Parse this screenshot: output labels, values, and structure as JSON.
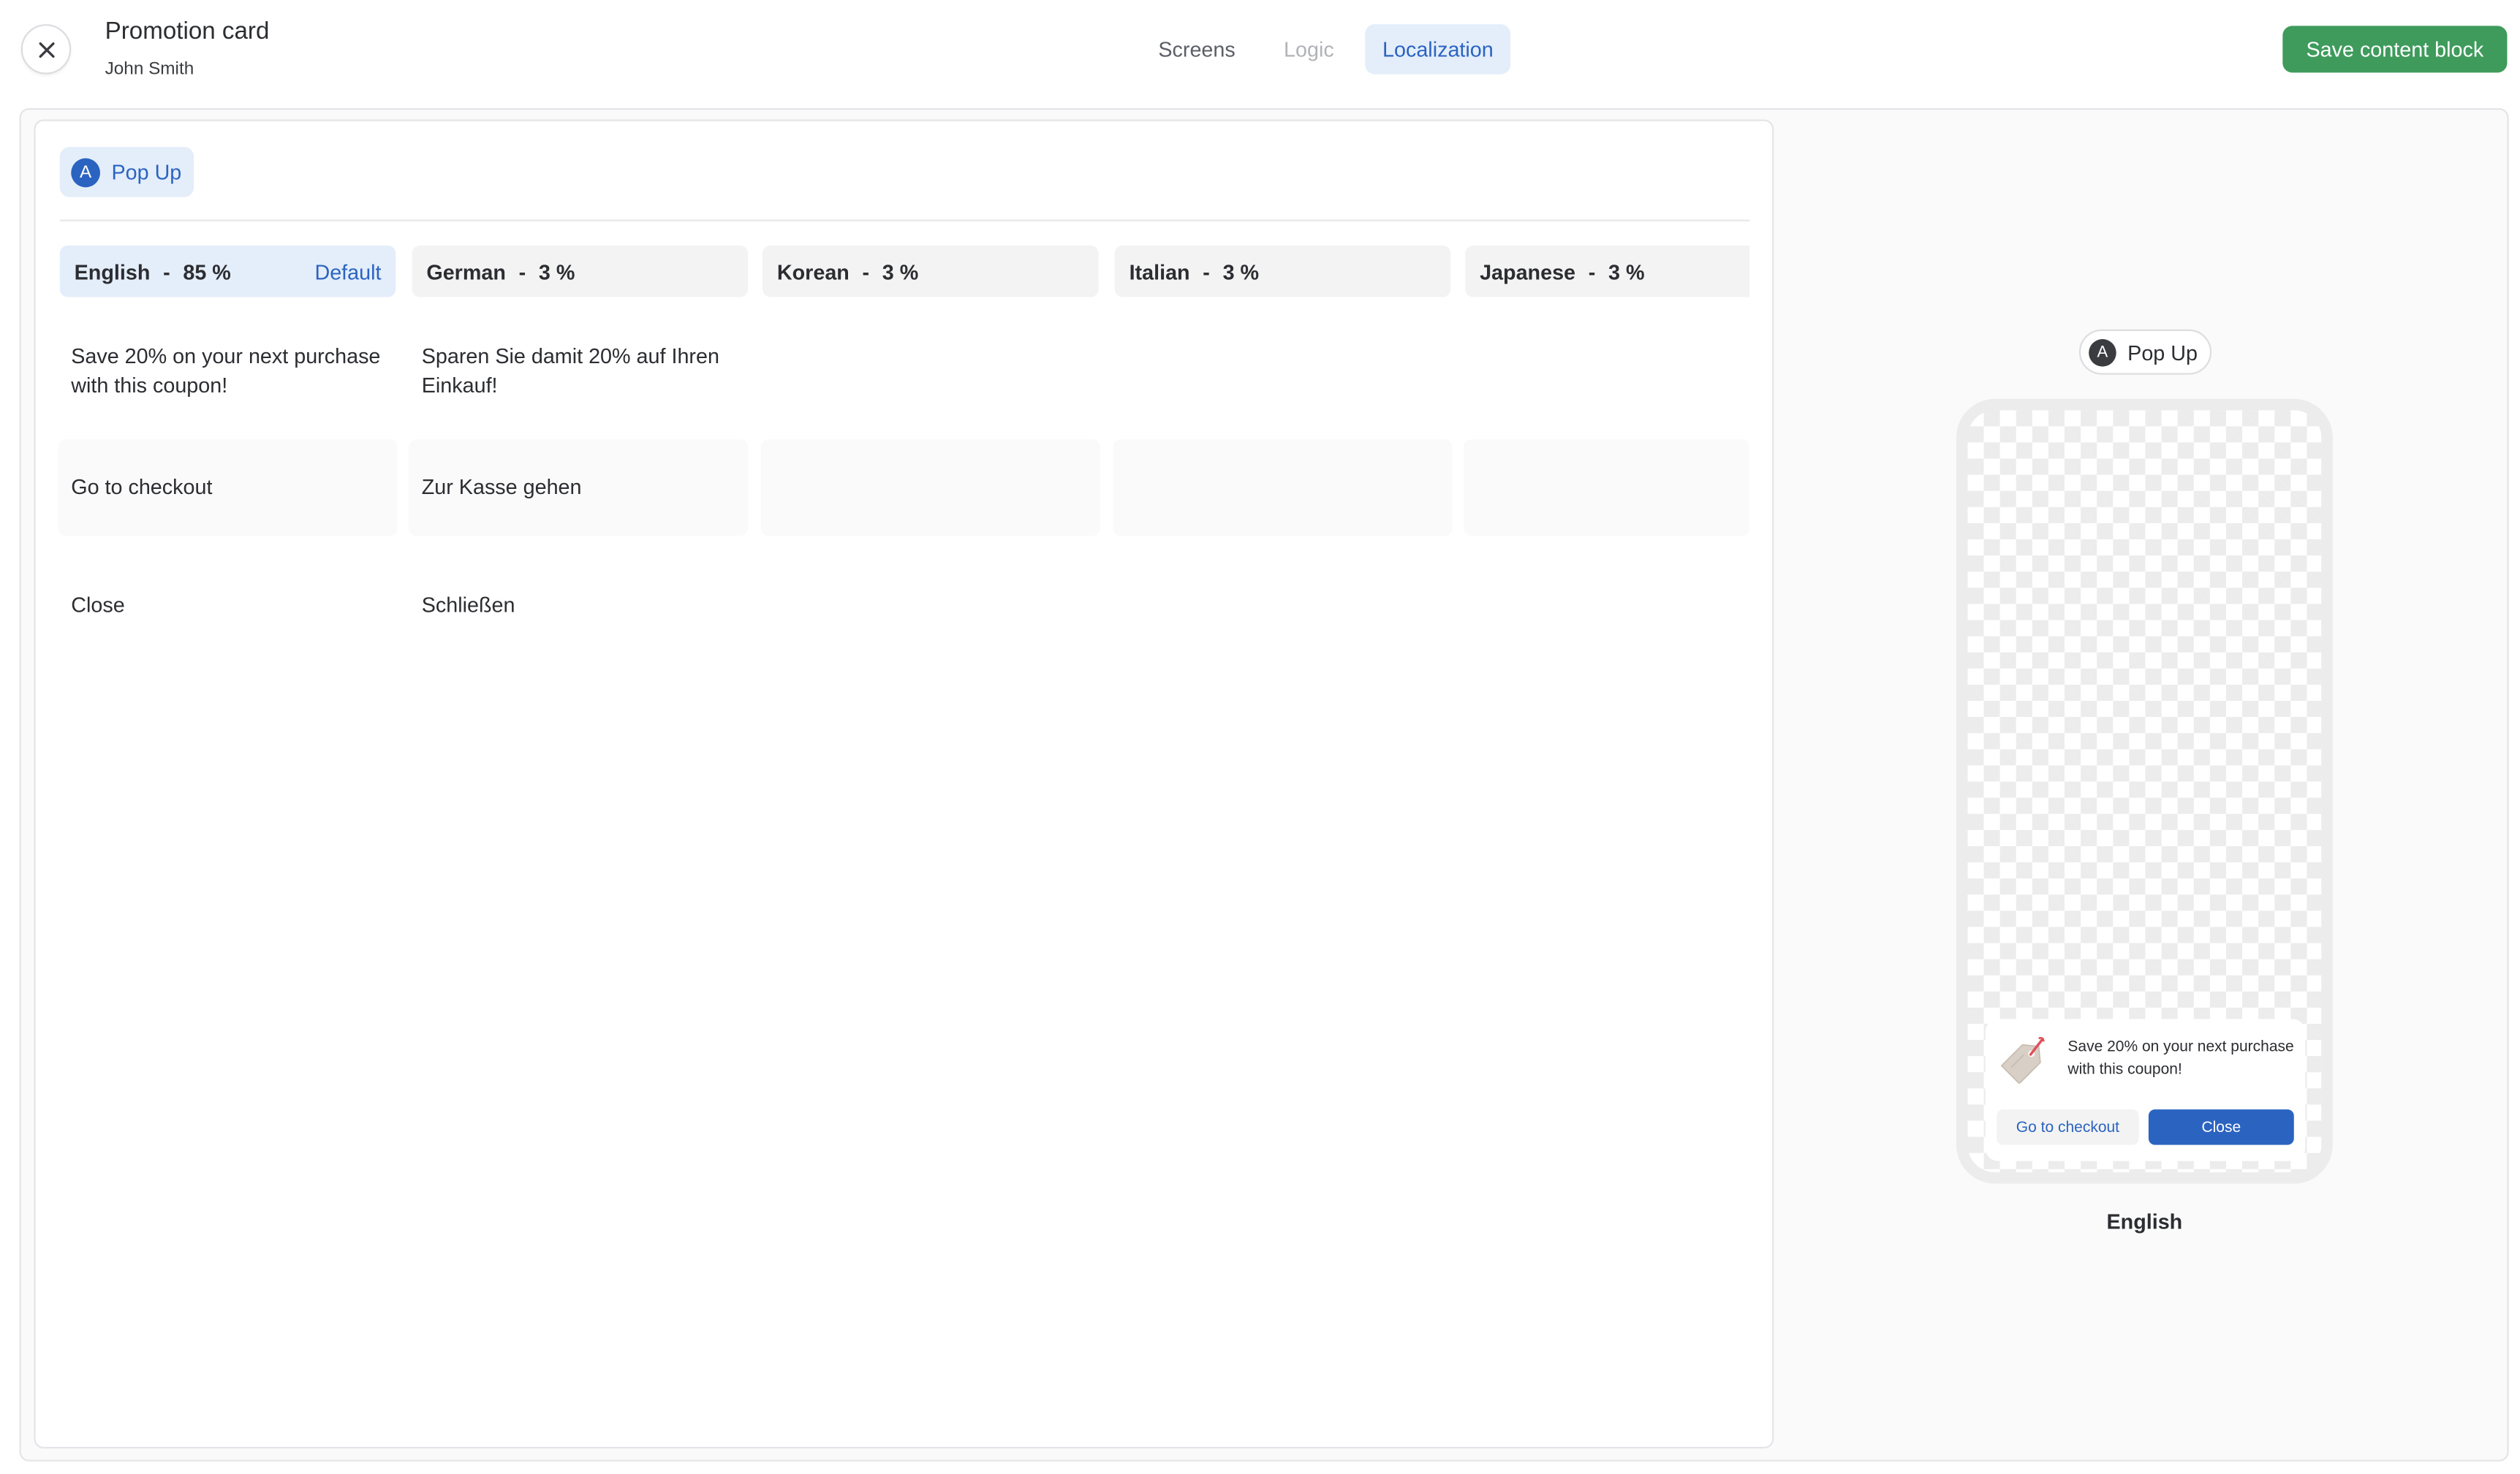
{
  "header": {
    "title": "Promotion card",
    "owner": "John Smith",
    "close_icon": "close-icon",
    "tabs": [
      {
        "label": "Screens",
        "state": "normal"
      },
      {
        "label": "Logic",
        "state": "disabled"
      },
      {
        "label": "Localization",
        "state": "active"
      }
    ],
    "save_label": "Save content block"
  },
  "editor": {
    "screen": {
      "badge": "A",
      "label": "Pop Up"
    },
    "languages": [
      {
        "name": "English",
        "sep": "-",
        "percent": "85 %",
        "default_label": "Default",
        "active": true
      },
      {
        "name": "German",
        "sep": "-",
        "percent": "3 %"
      },
      {
        "name": "Korean",
        "sep": "-",
        "percent": "3 %"
      },
      {
        "name": "Italian",
        "sep": "-",
        "percent": "3 %"
      },
      {
        "name": "Japanese",
        "sep": "-",
        "percent": "3 %"
      }
    ],
    "rows": [
      {
        "key": "message",
        "values": [
          "Save 20% on your next purchase with this coupon!",
          "Sparen Sie damit 20% auf Ihren Einkauf!",
          "",
          "",
          ""
        ]
      },
      {
        "key": "primary_button",
        "values": [
          "Go to checkout",
          "Zur Kasse gehen",
          "",
          "",
          ""
        ]
      },
      {
        "key": "secondary_button",
        "values": [
          "Close",
          "Schließen",
          "",
          "",
          ""
        ]
      }
    ]
  },
  "preview": {
    "screen": {
      "badge": "A",
      "label": "Pop Up"
    },
    "popup": {
      "icon": "coupon-tag-icon",
      "message": "Save 20% on your next purchase with this coupon!",
      "secondary_label": "Go to checkout",
      "primary_label": "Close"
    },
    "language": "English"
  },
  "colors": {
    "accent": "#2b63c1",
    "accent_light": "#e4eefb",
    "save_green": "#3e9b5c",
    "coupon_red": "#e0505a"
  }
}
